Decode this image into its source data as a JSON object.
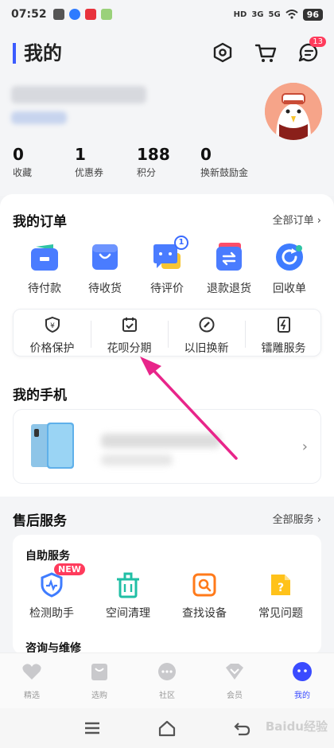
{
  "status_bar": {
    "time": "07:52",
    "network_1": "3G",
    "network_2": "5G",
    "network_label": "HD",
    "battery": "96"
  },
  "header": {
    "title": "我的",
    "message_badge": "13",
    "accent_color": "#3b5bff"
  },
  "stats": [
    {
      "value": "0",
      "label": "收藏"
    },
    {
      "value": "1",
      "label": "优惠券"
    },
    {
      "value": "188",
      "label": "积分"
    },
    {
      "value": "0",
      "label": "换新鼓励金"
    }
  ],
  "orders": {
    "title": "我的订单",
    "link": "全部订单 ›",
    "items": [
      {
        "label": "待付款",
        "icon": "wallet-icon"
      },
      {
        "label": "待收货",
        "icon": "package-icon"
      },
      {
        "label": "待评价",
        "icon": "review-chat-icon",
        "badge": "1"
      },
      {
        "label": "退款退货",
        "icon": "refund-icon"
      },
      {
        "label": "回收单",
        "icon": "recycle-icon"
      }
    ],
    "services": [
      {
        "label": "价格保护",
        "icon": "price-protect-icon"
      },
      {
        "label": "花呗分期",
        "icon": "installment-icon"
      },
      {
        "label": "以旧换新",
        "icon": "trade-in-icon"
      },
      {
        "label": "镭雕服务",
        "icon": "laser-engrave-icon"
      }
    ]
  },
  "phone": {
    "title": "我的手机",
    "chevron": "›"
  },
  "after_sales": {
    "title": "售后服务",
    "link": "全部服务 ›",
    "subtitle": "自助服务",
    "items": [
      {
        "label": "检测助手",
        "icon": "detect-icon",
        "badge": "NEW"
      },
      {
        "label": "空间清理",
        "icon": "clean-icon"
      },
      {
        "label": "查找设备",
        "icon": "find-device-icon"
      },
      {
        "label": "常见问题",
        "icon": "faq-icon"
      }
    ],
    "subtitle2": "咨询与维修"
  },
  "tabbar": {
    "items": [
      {
        "label": "精选",
        "icon": "heart-icon"
      },
      {
        "label": "选购",
        "icon": "bag-icon"
      },
      {
        "label": "社区",
        "icon": "community-icon"
      },
      {
        "label": "会员",
        "icon": "member-icon"
      },
      {
        "label": "我的",
        "icon": "profile-icon"
      }
    ],
    "active_color": "#3a4bff"
  },
  "watermark": "Baidu经验"
}
